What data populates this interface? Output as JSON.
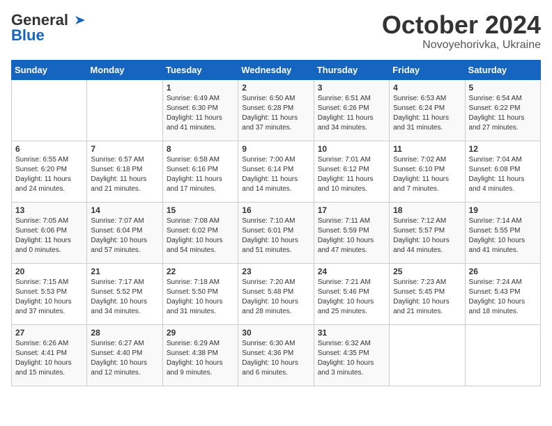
{
  "header": {
    "logo_line1": "General",
    "logo_line2": "Blue",
    "month": "October 2024",
    "location": "Novoyehorivka, Ukraine"
  },
  "weekdays": [
    "Sunday",
    "Monday",
    "Tuesday",
    "Wednesday",
    "Thursday",
    "Friday",
    "Saturday"
  ],
  "weeks": [
    [
      {
        "day": "",
        "info": ""
      },
      {
        "day": "",
        "info": ""
      },
      {
        "day": "1",
        "info": "Sunrise: 6:49 AM\nSunset: 6:30 PM\nDaylight: 11 hours and 41 minutes."
      },
      {
        "day": "2",
        "info": "Sunrise: 6:50 AM\nSunset: 6:28 PM\nDaylight: 11 hours and 37 minutes."
      },
      {
        "day": "3",
        "info": "Sunrise: 6:51 AM\nSunset: 6:26 PM\nDaylight: 11 hours and 34 minutes."
      },
      {
        "day": "4",
        "info": "Sunrise: 6:53 AM\nSunset: 6:24 PM\nDaylight: 11 hours and 31 minutes."
      },
      {
        "day": "5",
        "info": "Sunrise: 6:54 AM\nSunset: 6:22 PM\nDaylight: 11 hours and 27 minutes."
      }
    ],
    [
      {
        "day": "6",
        "info": "Sunrise: 6:55 AM\nSunset: 6:20 PM\nDaylight: 11 hours and 24 minutes."
      },
      {
        "day": "7",
        "info": "Sunrise: 6:57 AM\nSunset: 6:18 PM\nDaylight: 11 hours and 21 minutes."
      },
      {
        "day": "8",
        "info": "Sunrise: 6:58 AM\nSunset: 6:16 PM\nDaylight: 11 hours and 17 minutes."
      },
      {
        "day": "9",
        "info": "Sunrise: 7:00 AM\nSunset: 6:14 PM\nDaylight: 11 hours and 14 minutes."
      },
      {
        "day": "10",
        "info": "Sunrise: 7:01 AM\nSunset: 6:12 PM\nDaylight: 11 hours and 10 minutes."
      },
      {
        "day": "11",
        "info": "Sunrise: 7:02 AM\nSunset: 6:10 PM\nDaylight: 11 hours and 7 minutes."
      },
      {
        "day": "12",
        "info": "Sunrise: 7:04 AM\nSunset: 6:08 PM\nDaylight: 11 hours and 4 minutes."
      }
    ],
    [
      {
        "day": "13",
        "info": "Sunrise: 7:05 AM\nSunset: 6:06 PM\nDaylight: 11 hours and 0 minutes."
      },
      {
        "day": "14",
        "info": "Sunrise: 7:07 AM\nSunset: 6:04 PM\nDaylight: 10 hours and 57 minutes."
      },
      {
        "day": "15",
        "info": "Sunrise: 7:08 AM\nSunset: 6:02 PM\nDaylight: 10 hours and 54 minutes."
      },
      {
        "day": "16",
        "info": "Sunrise: 7:10 AM\nSunset: 6:01 PM\nDaylight: 10 hours and 51 minutes."
      },
      {
        "day": "17",
        "info": "Sunrise: 7:11 AM\nSunset: 5:59 PM\nDaylight: 10 hours and 47 minutes."
      },
      {
        "day": "18",
        "info": "Sunrise: 7:12 AM\nSunset: 5:57 PM\nDaylight: 10 hours and 44 minutes."
      },
      {
        "day": "19",
        "info": "Sunrise: 7:14 AM\nSunset: 5:55 PM\nDaylight: 10 hours and 41 minutes."
      }
    ],
    [
      {
        "day": "20",
        "info": "Sunrise: 7:15 AM\nSunset: 5:53 PM\nDaylight: 10 hours and 37 minutes."
      },
      {
        "day": "21",
        "info": "Sunrise: 7:17 AM\nSunset: 5:52 PM\nDaylight: 10 hours and 34 minutes."
      },
      {
        "day": "22",
        "info": "Sunrise: 7:18 AM\nSunset: 5:50 PM\nDaylight: 10 hours and 31 minutes."
      },
      {
        "day": "23",
        "info": "Sunrise: 7:20 AM\nSunset: 5:48 PM\nDaylight: 10 hours and 28 minutes."
      },
      {
        "day": "24",
        "info": "Sunrise: 7:21 AM\nSunset: 5:46 PM\nDaylight: 10 hours and 25 minutes."
      },
      {
        "day": "25",
        "info": "Sunrise: 7:23 AM\nSunset: 5:45 PM\nDaylight: 10 hours and 21 minutes."
      },
      {
        "day": "26",
        "info": "Sunrise: 7:24 AM\nSunset: 5:43 PM\nDaylight: 10 hours and 18 minutes."
      }
    ],
    [
      {
        "day": "27",
        "info": "Sunrise: 6:26 AM\nSunset: 4:41 PM\nDaylight: 10 hours and 15 minutes."
      },
      {
        "day": "28",
        "info": "Sunrise: 6:27 AM\nSunset: 4:40 PM\nDaylight: 10 hours and 12 minutes."
      },
      {
        "day": "29",
        "info": "Sunrise: 6:29 AM\nSunset: 4:38 PM\nDaylight: 10 hours and 9 minutes."
      },
      {
        "day": "30",
        "info": "Sunrise: 6:30 AM\nSunset: 4:36 PM\nDaylight: 10 hours and 6 minutes."
      },
      {
        "day": "31",
        "info": "Sunrise: 6:32 AM\nSunset: 4:35 PM\nDaylight: 10 hours and 3 minutes."
      },
      {
        "day": "",
        "info": ""
      },
      {
        "day": "",
        "info": ""
      }
    ]
  ]
}
